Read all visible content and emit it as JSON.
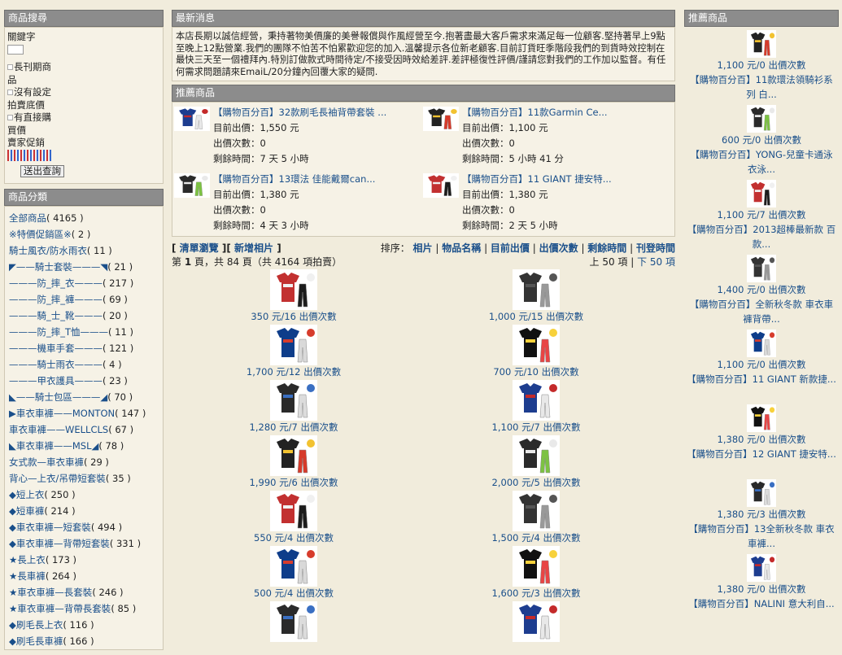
{
  "left": {
    "search": {
      "title": "商品搜尋",
      "keyword_label": "關鍵字",
      "option_1_a": "長刊期商",
      "option_1_b": "品",
      "option_2": "沒有設定",
      "option_3": "拍賣底價",
      "option_4": "有直接購",
      "option_4_b": "買價",
      "option_5": "賣家促銷",
      "submit": "送出查詢"
    },
    "categories_title": "商品分類",
    "categories": [
      {
        "label": "全部商品",
        "count": "( 4165 )"
      },
      {
        "label": "※特價促銷區※",
        "count": "( 2 )"
      },
      {
        "label": "騎士風衣/防水雨衣",
        "count": "( 11 )"
      },
      {
        "label": "◤——騎士套裝———◥",
        "count": "( 21 )"
      },
      {
        "label": "———防_摔_衣———",
        "count": "( 217 )"
      },
      {
        "label": "———防_摔_褲———",
        "count": "( 69 )"
      },
      {
        "label": "———騎_士_靴———",
        "count": "( 20 )"
      },
      {
        "label": "———防_摔_T恤———",
        "count": "( 11 )"
      },
      {
        "label": "———機車手套———",
        "count": "( 121 )"
      },
      {
        "label": "———騎士雨衣———",
        "count": "( 4 )"
      },
      {
        "label": "———甲衣護具———",
        "count": "( 23 )"
      },
      {
        "label": "◣——騎士包區———◢",
        "count": "( 70 )"
      },
      {
        "label": "▶車衣車褲——MONTON",
        "count": "( 147 )"
      },
      {
        "label": "車衣車褲——WELLCLS",
        "count": "( 67 )"
      },
      {
        "label": "◣車衣車褲——MSL◢",
        "count": "( 78 )"
      },
      {
        "label": "女式款—車衣車褲",
        "count": "( 29 )"
      },
      {
        "label": "背心—上衣/吊帶短套裝",
        "count": "( 35 )"
      },
      {
        "label": "◆短上衣",
        "count": "( 250 )"
      },
      {
        "label": "◆短車褲",
        "count": "( 214 )"
      },
      {
        "label": "◆車衣車褲—短套裝",
        "count": "( 494 )"
      },
      {
        "label": "◆車衣車褲—背帶短套裝",
        "count": "( 331 )"
      },
      {
        "label": "★長上衣",
        "count": "( 173 )"
      },
      {
        "label": "★長車褲",
        "count": "( 264 )"
      },
      {
        "label": "★車衣車褲—長套裝",
        "count": "( 246 )"
      },
      {
        "label": "★車衣車褲—背帶長套裝",
        "count": "( 85 )"
      },
      {
        "label": "◆刷毛長上衣",
        "count": "( 116 )"
      },
      {
        "label": "◆刷毛長車褲",
        "count": "( 166 )"
      }
    ]
  },
  "mid": {
    "news_title": "最新消息",
    "news_text": "本店長期以誠信經營，秉持著物美價廉的美譽報償與作風經營至今.抱著盡最大客戶需求來滿足每一位顧客.堅持著早上9點至晚上12點營業.我們的團隊不怕苦不怕累歡迎您的加入.溫馨提示各位新老顧客.目前訂貨旺季階段我們的到貨時效控制在最快三天至一個禮拜內.特別訂做款式時間待定/不接受因時效給差評.差評極復性評價/謹請您對我們的工作加以監督。有任何需求問題請來EmaiL/20分鐘內回覆大家的疑問.",
    "featured_title": "推薦商品",
    "featured": [
      {
        "title": "【購物百分百】32款刷毛長袖背帶套裝 ...",
        "price_label": "目前出價：",
        "price": "1,550 元",
        "bids": "出價次數：0",
        "remain": "剩餘時間：7 天 5 小時"
      },
      {
        "title": "【購物百分百】11款Garmin Ce...",
        "price_label": "目前出價：",
        "price": "1,100 元",
        "bids": "出價次數：0",
        "remain": "剩餘時間：5 小時 41 分"
      },
      {
        "title": "【購物百分百】13環法 佳能戴爾can...",
        "price_label": "目前出價：",
        "price": "1,380 元",
        "bids": "出價次數：0",
        "remain": "剩餘時間：4 天 3 小時"
      },
      {
        "title": "【購物百分百】11 GIANT 捷安特...",
        "price_label": "目前出價：",
        "price": "1,380 元",
        "bids": "出價次數：0",
        "remain": "剩餘時間：2 天 5 小時"
      }
    ],
    "links": {
      "browse": "清單瀏覽",
      "add_photo": "新增相片"
    },
    "sort_label": "排序：",
    "sort_options": [
      "相片",
      "物品名稱",
      "目前出價",
      "出價次數",
      "剩餘時間",
      "刊登時間"
    ],
    "page_info": {
      "prefix": "第 ",
      "page": "1",
      "middle": " 頁，共 84 頁（共 4164 項拍賣）"
    },
    "pager": {
      "prev": "上 50 項",
      "sep": " | ",
      "next": "下 50 項"
    },
    "grid": [
      {
        "cap": "350 元/16 出價次數"
      },
      {
        "cap": "1,000 元/15 出價次數"
      },
      {
        "cap": "1,700 元/12 出價次數"
      },
      {
        "cap": "700 元/10 出價次數"
      },
      {
        "cap": "1,280 元/7 出價次數"
      },
      {
        "cap": "1,100 元/7 出價次數"
      },
      {
        "cap": "1,990 元/6 出價次數"
      },
      {
        "cap": "2,000 元/5 出價次數"
      },
      {
        "cap": "550 元/4 出價次數"
      },
      {
        "cap": "1,500 元/4 出價次數"
      },
      {
        "cap": "500 元/4 出價次數"
      },
      {
        "cap": "1,600 元/3 出價次數"
      },
      {
        "cap": ""
      },
      {
        "cap": ""
      }
    ]
  },
  "right": {
    "title": "推薦商品",
    "items": [
      {
        "price": "1,100 元/0 出價次數",
        "name": "【購物百分百】11款環法領騎衫系列 白..."
      },
      {
        "price": "600 元/0 出價次數",
        "name": "【購物百分百】YONG-兒童卡通泳衣泳..."
      },
      {
        "price": "1,100 元/7 出價次數",
        "name": "【購物百分百】2013超棒最新款 百款..."
      },
      {
        "price": "1,400 元/0 出價次數",
        "name": "【購物百分百】全新秋冬款 車衣車褲背帶..."
      },
      {
        "price": "1,100 元/0 出價次數",
        "name": "【購物百分百】11 GIANT 新款捷..."
      },
      {
        "price": "1,380 元/0 出價次數",
        "name": "【購物百分百】12 GIANT 捷安特..."
      },
      {
        "price": "1,380 元/3 出價次數",
        "name": "【購物百分百】13全新秋冬款 車衣車褲..."
      },
      {
        "price": "1,380 元/0 出價次數",
        "name": "【購物百分百】NALINI 意大利自..."
      }
    ]
  }
}
